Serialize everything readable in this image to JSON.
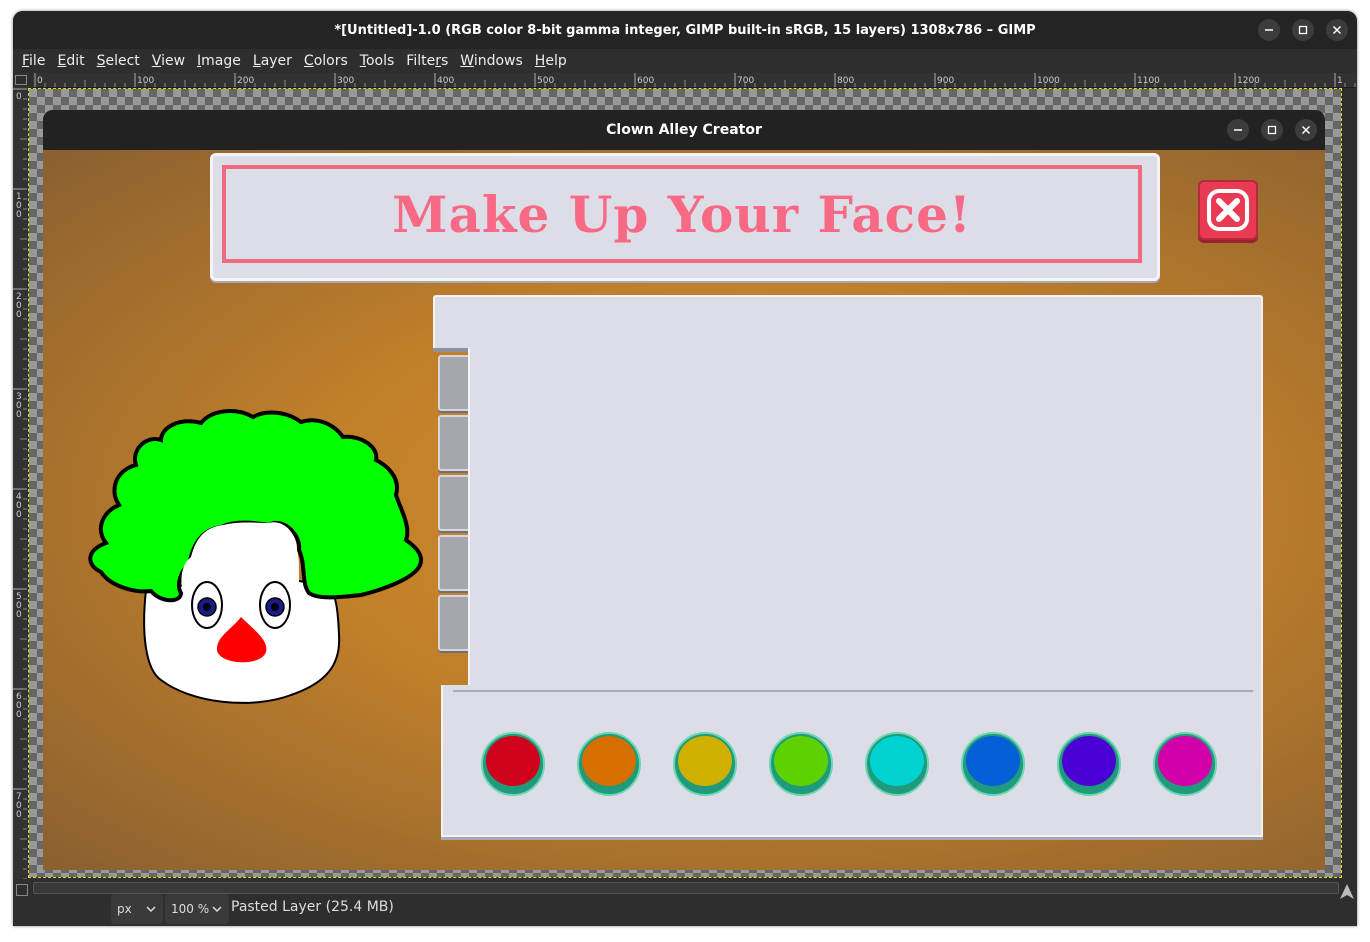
{
  "window": {
    "title": "*[Untitled]-1.0 (RGB color 8-bit gamma integer, GIMP built-in sRGB, 15 layers) 1308x786 – GIMP",
    "controls": [
      "minimize-icon",
      "maximize-icon",
      "close-icon"
    ]
  },
  "menubar": {
    "items": [
      {
        "label": "File",
        "mnemonic": "F",
        "rest": "ile"
      },
      {
        "label": "Edit",
        "mnemonic": "E",
        "rest": "dit"
      },
      {
        "label": "Select",
        "mnemonic": "S",
        "rest": "elect"
      },
      {
        "label": "View",
        "mnemonic": "V",
        "rest": "iew"
      },
      {
        "label": "Image",
        "mnemonic": "I",
        "rest": "mage"
      },
      {
        "label": "Layer",
        "mnemonic": "L",
        "rest": "ayer"
      },
      {
        "label": "Colors",
        "mnemonic": "C",
        "rest": "olors"
      },
      {
        "label": "Tools",
        "mnemonic": "T",
        "rest": "ools"
      },
      {
        "label": "Filters",
        "pre": "Filte",
        "mnemonic": "r",
        "rest": "s"
      },
      {
        "label": "Windows",
        "mnemonic": "W",
        "rest": "indows"
      },
      {
        "label": "Help",
        "mnemonic": "H",
        "rest": "elp"
      }
    ]
  },
  "rulers": {
    "horizontal_ticks": [
      "0",
      "100",
      "200",
      "300",
      "400",
      "500",
      "600",
      "700",
      "800",
      "900",
      "1000",
      "1100",
      "1200",
      "1"
    ],
    "vertical_ticks": [
      "0",
      "100",
      "200",
      "300",
      "400",
      "500",
      "600",
      "700"
    ]
  },
  "app": {
    "title": "Clown Alley Creator",
    "banner_text": "Make Up Your Face!",
    "close_button_icon": "close-x-icon",
    "tab_count": 5,
    "swatch_colors": [
      "#d0021b",
      "#d46f00",
      "#cfb000",
      "#5ed100",
      "#00d2d2",
      "#0560d8",
      "#4a00d4",
      "#d200a8"
    ],
    "colors": {
      "stage": "#c4822a",
      "banner_bg": "#dcdde6",
      "banner_accent": "#f76984",
      "close_button": "#e83a52",
      "swatch_ring": "#1f9a7a"
    }
  },
  "clown": {
    "hair_color": "#00ff00",
    "face_color": "#ffffff",
    "nose_color": "#ff0000",
    "eye_color": "#1a1a8a"
  },
  "statusbar": {
    "unit": "px",
    "zoom": "100 %",
    "message": "Pasted Layer (25.4 MB)"
  }
}
